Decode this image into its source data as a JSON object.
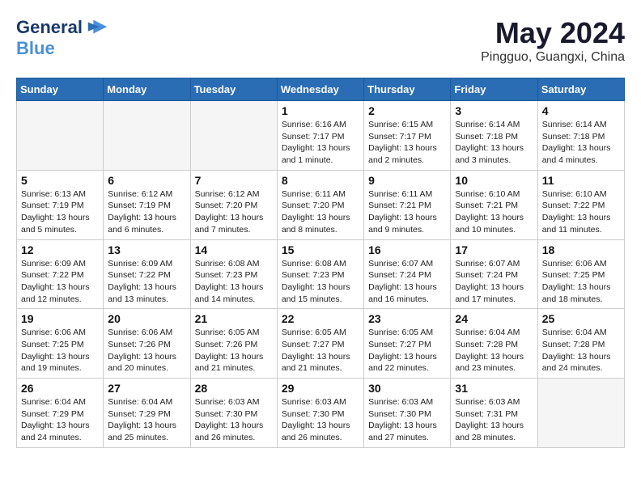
{
  "logo": {
    "line1": "General",
    "line2": "Blue"
  },
  "title": "May 2024",
  "subtitle": "Pingguo, Guangxi, China",
  "weekdays": [
    "Sunday",
    "Monday",
    "Tuesday",
    "Wednesday",
    "Thursday",
    "Friday",
    "Saturday"
  ],
  "weeks": [
    [
      {
        "day": "",
        "info": ""
      },
      {
        "day": "",
        "info": ""
      },
      {
        "day": "",
        "info": ""
      },
      {
        "day": "1",
        "info": "Sunrise: 6:16 AM\nSunset: 7:17 PM\nDaylight: 13 hours and 1 minute."
      },
      {
        "day": "2",
        "info": "Sunrise: 6:15 AM\nSunset: 7:17 PM\nDaylight: 13 hours and 2 minutes."
      },
      {
        "day": "3",
        "info": "Sunrise: 6:14 AM\nSunset: 7:18 PM\nDaylight: 13 hours and 3 minutes."
      },
      {
        "day": "4",
        "info": "Sunrise: 6:14 AM\nSunset: 7:18 PM\nDaylight: 13 hours and 4 minutes."
      }
    ],
    [
      {
        "day": "5",
        "info": "Sunrise: 6:13 AM\nSunset: 7:19 PM\nDaylight: 13 hours and 5 minutes."
      },
      {
        "day": "6",
        "info": "Sunrise: 6:12 AM\nSunset: 7:19 PM\nDaylight: 13 hours and 6 minutes."
      },
      {
        "day": "7",
        "info": "Sunrise: 6:12 AM\nSunset: 7:20 PM\nDaylight: 13 hours and 7 minutes."
      },
      {
        "day": "8",
        "info": "Sunrise: 6:11 AM\nSunset: 7:20 PM\nDaylight: 13 hours and 8 minutes."
      },
      {
        "day": "9",
        "info": "Sunrise: 6:11 AM\nSunset: 7:21 PM\nDaylight: 13 hours and 9 minutes."
      },
      {
        "day": "10",
        "info": "Sunrise: 6:10 AM\nSunset: 7:21 PM\nDaylight: 13 hours and 10 minutes."
      },
      {
        "day": "11",
        "info": "Sunrise: 6:10 AM\nSunset: 7:22 PM\nDaylight: 13 hours and 11 minutes."
      }
    ],
    [
      {
        "day": "12",
        "info": "Sunrise: 6:09 AM\nSunset: 7:22 PM\nDaylight: 13 hours and 12 minutes."
      },
      {
        "day": "13",
        "info": "Sunrise: 6:09 AM\nSunset: 7:22 PM\nDaylight: 13 hours and 13 minutes."
      },
      {
        "day": "14",
        "info": "Sunrise: 6:08 AM\nSunset: 7:23 PM\nDaylight: 13 hours and 14 minutes."
      },
      {
        "day": "15",
        "info": "Sunrise: 6:08 AM\nSunset: 7:23 PM\nDaylight: 13 hours and 15 minutes."
      },
      {
        "day": "16",
        "info": "Sunrise: 6:07 AM\nSunset: 7:24 PM\nDaylight: 13 hours and 16 minutes."
      },
      {
        "day": "17",
        "info": "Sunrise: 6:07 AM\nSunset: 7:24 PM\nDaylight: 13 hours and 17 minutes."
      },
      {
        "day": "18",
        "info": "Sunrise: 6:06 AM\nSunset: 7:25 PM\nDaylight: 13 hours and 18 minutes."
      }
    ],
    [
      {
        "day": "19",
        "info": "Sunrise: 6:06 AM\nSunset: 7:25 PM\nDaylight: 13 hours and 19 minutes."
      },
      {
        "day": "20",
        "info": "Sunrise: 6:06 AM\nSunset: 7:26 PM\nDaylight: 13 hours and 20 minutes."
      },
      {
        "day": "21",
        "info": "Sunrise: 6:05 AM\nSunset: 7:26 PM\nDaylight: 13 hours and 21 minutes."
      },
      {
        "day": "22",
        "info": "Sunrise: 6:05 AM\nSunset: 7:27 PM\nDaylight: 13 hours and 21 minutes."
      },
      {
        "day": "23",
        "info": "Sunrise: 6:05 AM\nSunset: 7:27 PM\nDaylight: 13 hours and 22 minutes."
      },
      {
        "day": "24",
        "info": "Sunrise: 6:04 AM\nSunset: 7:28 PM\nDaylight: 13 hours and 23 minutes."
      },
      {
        "day": "25",
        "info": "Sunrise: 6:04 AM\nSunset: 7:28 PM\nDaylight: 13 hours and 24 minutes."
      }
    ],
    [
      {
        "day": "26",
        "info": "Sunrise: 6:04 AM\nSunset: 7:29 PM\nDaylight: 13 hours and 24 minutes."
      },
      {
        "day": "27",
        "info": "Sunrise: 6:04 AM\nSunset: 7:29 PM\nDaylight: 13 hours and 25 minutes."
      },
      {
        "day": "28",
        "info": "Sunrise: 6:03 AM\nSunset: 7:30 PM\nDaylight: 13 hours and 26 minutes."
      },
      {
        "day": "29",
        "info": "Sunrise: 6:03 AM\nSunset: 7:30 PM\nDaylight: 13 hours and 26 minutes."
      },
      {
        "day": "30",
        "info": "Sunrise: 6:03 AM\nSunset: 7:30 PM\nDaylight: 13 hours and 27 minutes."
      },
      {
        "day": "31",
        "info": "Sunrise: 6:03 AM\nSunset: 7:31 PM\nDaylight: 13 hours and 28 minutes."
      },
      {
        "day": "",
        "info": ""
      }
    ]
  ]
}
